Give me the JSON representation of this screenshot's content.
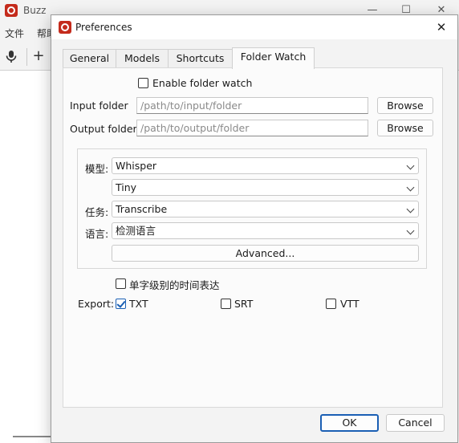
{
  "main_window": {
    "title": "Buzz",
    "menu": [
      "文件",
      "帮助"
    ],
    "controls": {
      "minimize": "—",
      "maximize": "☐",
      "close": "✕"
    },
    "toolbar": {
      "mic_icon": "microphone-icon",
      "add_icon": "+"
    }
  },
  "dialog": {
    "title": "Preferences",
    "close": "✕",
    "tabs": [
      {
        "label": "General",
        "active": false
      },
      {
        "label": "Models",
        "active": false
      },
      {
        "label": "Shortcuts",
        "active": false
      },
      {
        "label": "Folder Watch",
        "active": true
      }
    ],
    "folder_watch": {
      "enable_label": "Enable folder watch",
      "enable_checked": false,
      "input_folder": {
        "label": "Input folder",
        "placeholder": "/path/to/input/folder",
        "browse": "Browse"
      },
      "output_folder": {
        "label": "Output folder",
        "placeholder": "/path/to/output/folder",
        "browse": "Browse"
      },
      "model_label": "模型:",
      "model_value": "Whisper",
      "model_size_value": "Tiny",
      "task_label": "任务:",
      "task_value": "Transcribe",
      "language_label": "语言:",
      "language_value": "检测语言",
      "advanced_button": "Advanced...",
      "word_timestamps_label": "单字级别的时间表达",
      "word_timestamps_checked": false,
      "export_label": "Export:",
      "export_options": [
        {
          "label": "TXT",
          "checked": true
        },
        {
          "label": "SRT",
          "checked": false
        },
        {
          "label": "VTT",
          "checked": false
        }
      ]
    },
    "ok_button": "OK",
    "cancel_button": "Cancel"
  },
  "colors": {
    "accent": "#1a5fb4",
    "brand": "#c42b1c"
  }
}
